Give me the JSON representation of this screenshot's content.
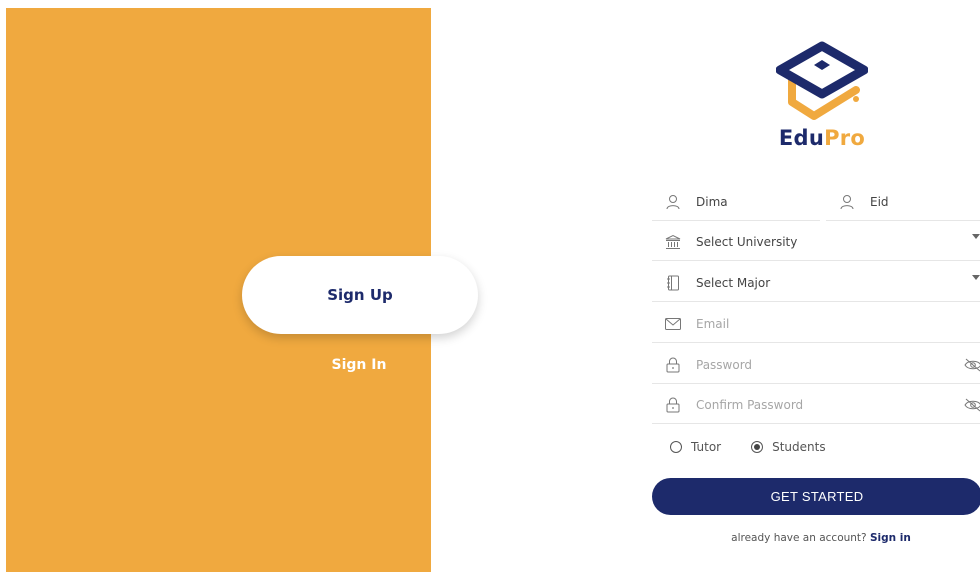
{
  "left_panel": {
    "signup_label": "Sign Up",
    "signin_label": "Sign In",
    "color": "#f0a93f"
  },
  "brand": {
    "name_primary": "Edu",
    "name_secondary": "Pro",
    "primary_color": "#1d2a6b",
    "accent_color": "#f0a93f",
    "icon": "graduation-cap-icon"
  },
  "form": {
    "first_name": {
      "value": "Dima",
      "icon": "user-icon"
    },
    "last_name": {
      "value": "Eid",
      "icon": "user-icon"
    },
    "university": {
      "value": "Select University",
      "icon": "university-icon"
    },
    "major": {
      "value": "Select Major",
      "icon": "notebook-icon"
    },
    "email": {
      "placeholder": "Email",
      "icon": "mail-icon"
    },
    "password": {
      "placeholder": "Password",
      "icon": "lock-icon"
    },
    "confirm_password": {
      "placeholder": "Confirm Password",
      "icon": "lock-icon"
    },
    "role_options": [
      {
        "label": "Tutor",
        "selected": false
      },
      {
        "label": "Students",
        "selected": true
      }
    ],
    "submit_label": "GET STARTED",
    "footer_text": "already have an account?",
    "footer_link": "Sign in"
  }
}
